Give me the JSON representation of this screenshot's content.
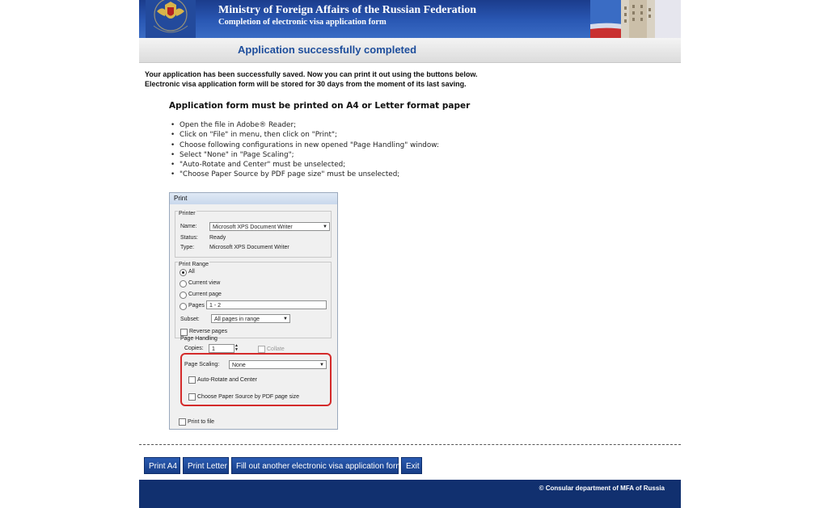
{
  "header": {
    "title": "Ministry of Foreign Affairs of the Russian Federation",
    "subtitle": "Completion of electronic visa application form",
    "logo_icon": "ministry-crest-icon",
    "banner_image_icon": "moscow-building-flag-icon"
  },
  "page_title": "Application successfully completed",
  "message": {
    "line1": "Your application has been successfully saved. Now you can print it out using the buttons below.",
    "line2": "Electronic visa application form will be stored for 30 days from the moment of its last saving."
  },
  "instructions": {
    "heading": "Application form must be printed on A4 or Letter format paper",
    "steps": [
      "Open the file in Adobe® Reader;",
      "Click on \"File\" in menu, then click on \"Print\";",
      "Choose following configurations in new opened \"Page Handling\" window:",
      "Select \"None\" in \"Page Scaling\";",
      "\"Auto-Rotate and Center\" must be unselected;",
      "\"Choose Paper Source by PDF page size\" must be unselected;"
    ]
  },
  "print_dialog": {
    "caption": "Print",
    "printer_group": "Printer",
    "name_label": "Name:",
    "name_value": "Microsoft XPS Document Writer",
    "status_label": "Status:",
    "status_value": "Ready",
    "type_label": "Type:",
    "type_value": "Microsoft XPS Document Writer",
    "range_group": "Print Range",
    "opt_all": "All",
    "opt_current_view": "Current view",
    "opt_current_page": "Current page",
    "opt_pages": "Pages",
    "pages_value": "1 - 2",
    "subset_label": "Subset:",
    "subset_value": "All pages in range",
    "reverse_pages": "Reverse pages",
    "handling_group": "Page Handling",
    "copies_label": "Copies:",
    "copies_value": "1",
    "collate": "Collate",
    "scaling_label": "Page Scaling:",
    "scaling_value": "None",
    "auto_rotate": "Auto-Rotate and Center",
    "paper_source": "Choose Paper Source by PDF page size",
    "print_to_file": "Print to file",
    "highlight_color": "#d42a2a"
  },
  "buttons": {
    "print_a4": "Print A4",
    "print_letter": "Print Letter",
    "fill_another": "Fill out another electronic visa application form",
    "exit": "Exit"
  },
  "footer": {
    "copyright": "© Consular department of MFA of Russia"
  },
  "colors": {
    "banner": "#1b3c8c",
    "title_text": "#1e4e9c",
    "button": "#1f4c9e",
    "footer": "#11306f"
  }
}
